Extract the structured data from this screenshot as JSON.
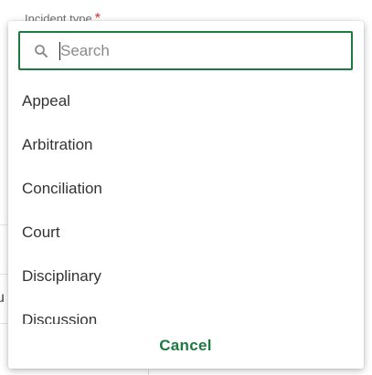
{
  "background": {
    "field_label": "Incident type",
    "required_mark": "*",
    "partial_text": "u"
  },
  "picker": {
    "search": {
      "placeholder": "Search",
      "value": "",
      "icon": "search-icon"
    },
    "options": [
      {
        "label": "Appeal"
      },
      {
        "label": "Arbitration"
      },
      {
        "label": "Conciliation"
      },
      {
        "label": "Court"
      },
      {
        "label": "Disciplinary"
      },
      {
        "label": "Discussion"
      }
    ],
    "cancel_label": "Cancel"
  },
  "colors": {
    "accent": "#1b7a3e",
    "required": "#d32f2f",
    "text": "#333333",
    "placeholder": "#8a8a8a"
  }
}
